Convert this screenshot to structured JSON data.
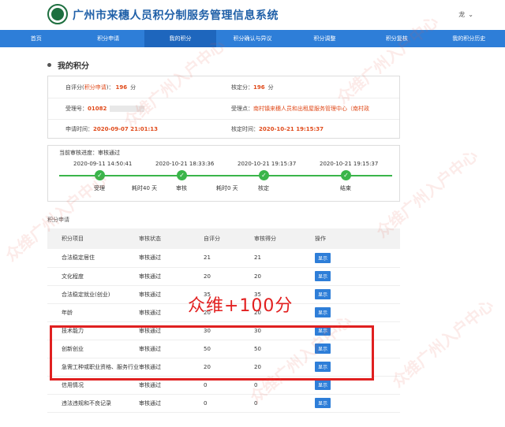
{
  "header": {
    "title": "广州市来穗人员积分制服务管理信息系统",
    "user": "龙",
    "user_caret": "⌄"
  },
  "nav": {
    "items": [
      "首页",
      "积分申请",
      "我的积分",
      "积分确认与异议",
      "积分调整",
      "积分复核",
      "我的积分历史"
    ],
    "active_index": 2
  },
  "section": {
    "title": "我的积分"
  },
  "info": {
    "self_score_label": "自评分(",
    "self_score_tag": "积分申请",
    "self_score_label_end": ")：",
    "self_score_value": "196",
    "self_score_unit": "分",
    "verified_label": "核定分：",
    "verified_value": "196",
    "verified_unit": "分",
    "receipt_label": "受理号：",
    "receipt_value": "01082",
    "office_label": "受理点：",
    "office_value": "南村镇来穗人员和出租屋服务管理中心（南村政",
    "apply_time_label": "申请时间：",
    "apply_time_value": "2020-09-07 21:01:13",
    "verify_time_label": "核定时间：",
    "verify_time_value": "2020-10-21 19:15:37"
  },
  "progress": {
    "status_label": "当前审核进度：",
    "status_value": "审核通过",
    "steps": [
      {
        "date": "2020-09-11 14:50:41",
        "label": "受理"
      },
      {
        "date": "2020-10-21 18:33:36",
        "label": "审核"
      },
      {
        "date": "2020-10-21 19:15:37",
        "label": "核定"
      },
      {
        "date": "2020-10-21 19:15:37",
        "label": "结束"
      }
    ],
    "gaps": [
      "耗时40 天",
      "耗时0 天"
    ],
    "check": "✓"
  },
  "table": {
    "title": "积分申请",
    "headers": [
      "积分项目",
      "审核状态",
      "自评分",
      "审核得分",
      "操作"
    ],
    "rows": [
      {
        "item": "合法稳定居住",
        "status": "审核通过",
        "self": "21",
        "score": "21",
        "action": "显示"
      },
      {
        "item": "文化程度",
        "status": "审核通过",
        "self": "20",
        "score": "20",
        "action": "显示"
      },
      {
        "item": "合法稳定就业(创业)",
        "status": "审核通过",
        "self": "35",
        "score": "35",
        "action": "显示"
      },
      {
        "item": "年龄",
        "status": "审核通过",
        "self": "20",
        "score": "20",
        "action": "显示"
      },
      {
        "item": "技术能力",
        "status": "审核通过",
        "self": "30",
        "score": "30",
        "action": "显示"
      },
      {
        "item": "创新创业",
        "status": "审核通过",
        "self": "50",
        "score": "50",
        "action": "显示"
      },
      {
        "item": "急需工种或职业资格、服务行业",
        "status": "审核通过",
        "self": "20",
        "score": "20",
        "action": "显示"
      },
      {
        "item": "信用情况",
        "status": "审核通过",
        "self": "0",
        "score": "0",
        "action": "显示"
      },
      {
        "item": "违法违规和不良记录",
        "status": "审核通过",
        "self": "0",
        "score": "0",
        "action": "显示"
      }
    ]
  },
  "annotation": {
    "text": "众维+100分"
  },
  "watermark": {
    "text": "众维广州入户中心"
  },
  "colors": {
    "nav": "#2e7ed8",
    "accent_red": "#e02020",
    "progress_green": "#3ab54a"
  }
}
